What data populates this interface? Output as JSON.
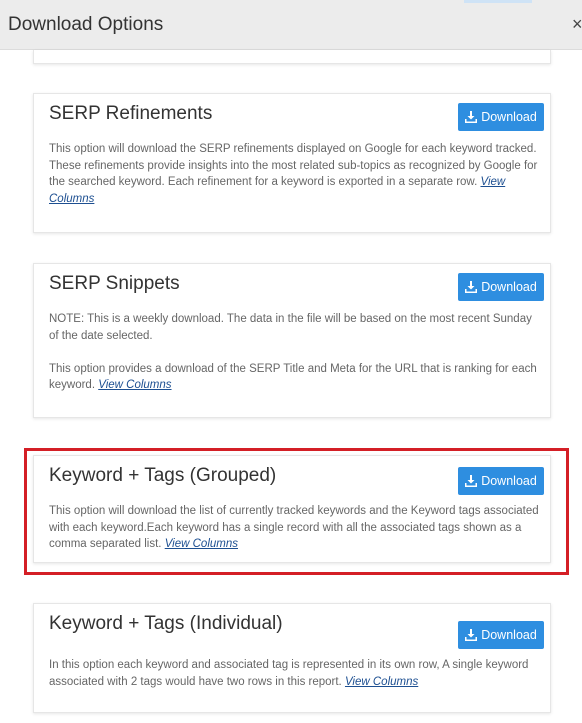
{
  "header": {
    "title": "Download Options",
    "close_glyph": "×"
  },
  "button_label": "Download",
  "view_columns_label": "View Columns",
  "cards": [
    {
      "title": "SERP Refinements",
      "paragraphs": [
        "This option will download the SERP refinements displayed on Google for each keyword tracked. These refinements provide insights into the most related sub-topics as recognized by Google for the searched keyword. Each refinement for a keyword is exported in a separate row."
      ]
    },
    {
      "title": "SERP Snippets",
      "paragraphs": [
        "NOTE: This is a weekly download. The data in the file will be based on the most recent Sunday of the date selected.",
        "This option provides a download of the SERP Title and Meta for the URL that is ranking for each keyword."
      ]
    },
    {
      "title": "Keyword + Tags (Grouped)",
      "paragraphs": [
        "This option will download the list of currently tracked keywords and the Keyword tags associated with each keyword.Each keyword has a single record with all the associated tags shown as a comma separated list."
      ]
    },
    {
      "title": "Keyword + Tags (Individual)",
      "paragraphs": [
        "In this option each keyword and associated tag is represented in its own row, A single keyword associated with 2 tags would have two rows in this report."
      ]
    }
  ],
  "colors": {
    "button": "#2e8ee0",
    "highlight": "#d41f26",
    "link": "#1d4f91"
  }
}
